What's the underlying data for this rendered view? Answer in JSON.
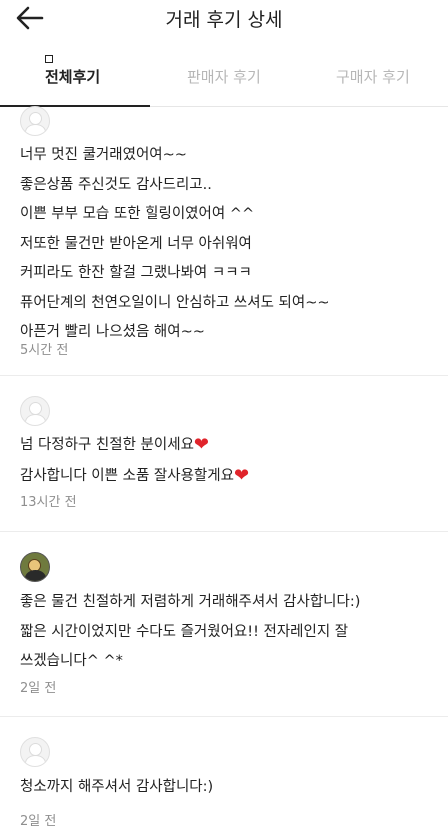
{
  "header": {
    "title": "거래 후기 상세",
    "back_icon": "arrow-left-icon"
  },
  "tabs": [
    {
      "label": "전체후기",
      "active": true
    },
    {
      "label": "판매자 후기",
      "active": false
    },
    {
      "label": "구매자 후기",
      "active": false
    }
  ],
  "reviews": [
    {
      "avatar": "default",
      "lines": [
        "너무 멋진 쿨거래였어여~~",
        "좋은상품 주신것도 감사드리고..",
        "이쁜 부부 모습 또한 힐링이였어여 ^^",
        "저또한 물건만 받아온게 너무 아쉬워여",
        "커피라도 한잔 할걸 그랬나봐여 ㅋㅋㅋ",
        "퓨어단계의 천연오일이니 안심하고 쓰셔도 되여~~",
        "아픈거 빨리 나으셨음 해여~~"
      ],
      "time": "5시간 전"
    },
    {
      "avatar": "default",
      "lines": [
        "넘 다정하구 친절한 분이세요",
        "감사합니다 이쁜 소품 잘사용할게요"
      ],
      "heart_icon": "heart-icon",
      "time": "13시간 전"
    },
    {
      "avatar": "photo",
      "lines": [
        "좋은 물건 친절하게 저렴하게 거래해주셔서 감사합니다:)",
        "짧은 시간이었지만 수다도 즐거웠어요!! 전자레인지 잘",
        "쓰겠습니다^ ^*"
      ],
      "time": "2일 전"
    },
    {
      "avatar": "default",
      "lines": [
        "청소까지 해주셔서 감사합니다:)"
      ],
      "time": "2일 전"
    }
  ],
  "colors": {
    "text": "#222222",
    "muted": "#8f8f8f",
    "inactive_tab": "#b7b7b7",
    "heart": "#e0242b"
  }
}
